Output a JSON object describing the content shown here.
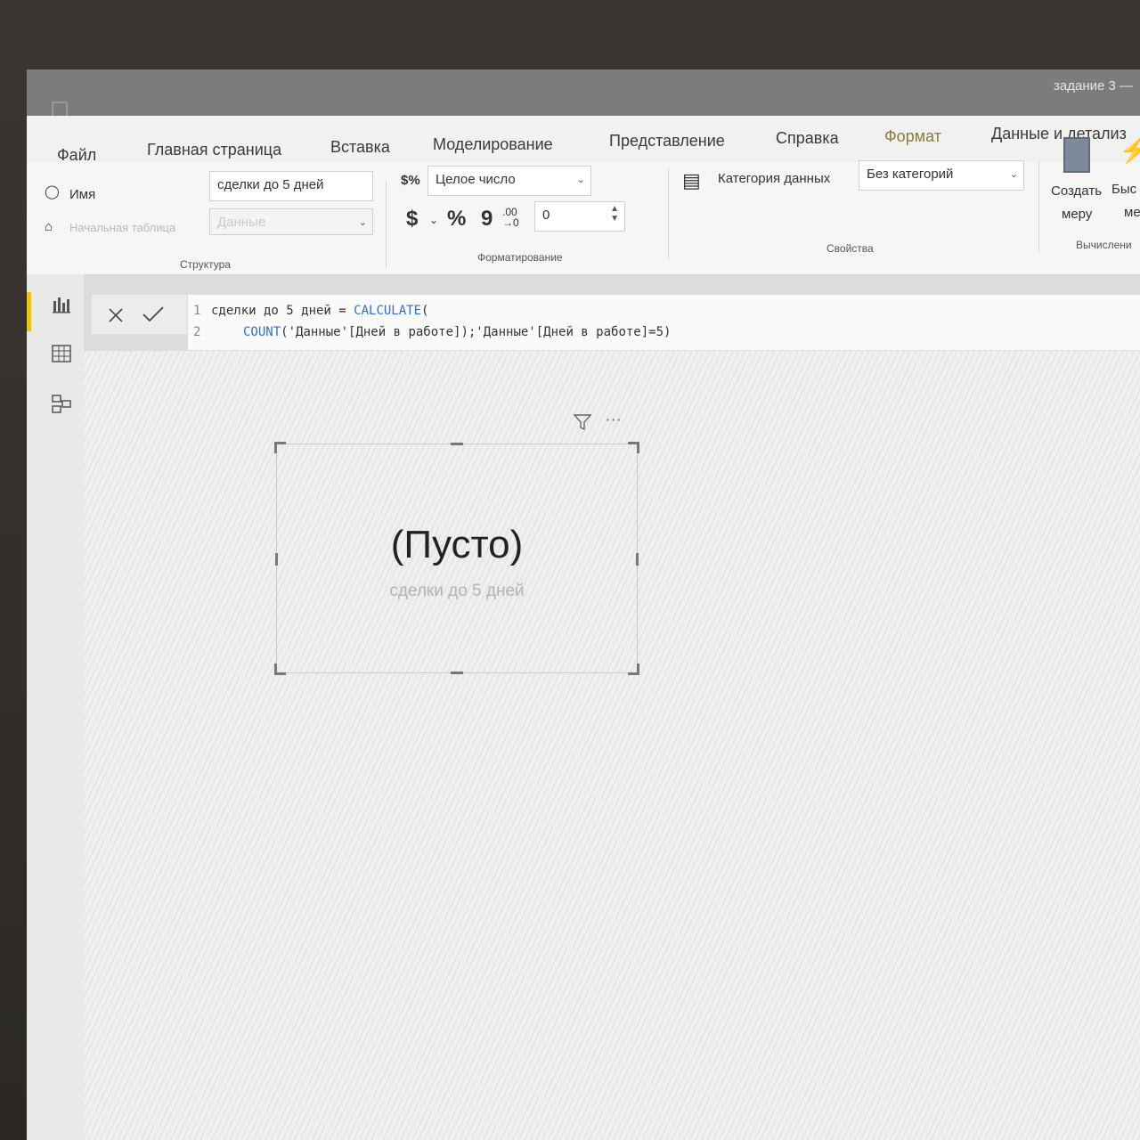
{
  "window": {
    "title": "задание 3 —"
  },
  "tabs": [
    {
      "label": "Файл"
    },
    {
      "label": "Главная страница"
    },
    {
      "label": "Вставка"
    },
    {
      "label": "Моделирование"
    },
    {
      "label": "Представление"
    },
    {
      "label": "Справка"
    },
    {
      "label": "Формат"
    },
    {
      "label": "Данные и детализ"
    }
  ],
  "ribbon": {
    "structure": {
      "name_label": "Имя",
      "name_value": "сделки до 5 дней",
      "home_table_label": "Начальная таблица",
      "home_table_value": "Данные",
      "group_label": "Структура"
    },
    "formatting": {
      "format_value": "Целое число",
      "currency_symbol": "$",
      "percent_symbol": "%",
      "comma_symbol": "9",
      "decimals_value": "0",
      "group_label": "Форматирование"
    },
    "properties": {
      "category_label": "Категория данных",
      "category_value": "Без категорий",
      "group_label": "Свойства"
    },
    "calculations": {
      "new_measure_label_1": "Создать",
      "new_measure_label_2": "меру",
      "quick_label_1": "Быс",
      "quick_label_2": "ме",
      "group_label": "Вычислени"
    }
  },
  "formula": {
    "line1_num": "1",
    "line1_text": "сделки до 5 дней = ",
    "line1_func": "CALCULATE",
    "line1_paren": "(",
    "line2_num": "2",
    "line2_func": "COUNT",
    "line2_text": "('Данные'[Дней в работе]);'Данные'[Дней в работе]=5)"
  },
  "card": {
    "value": "(Пусто)",
    "label": "сделки до 5 дней",
    "more_icon_text": "···"
  },
  "colors": {
    "accent_yellow": "#e8c619",
    "dax_keyword": "#2f6fd6"
  }
}
